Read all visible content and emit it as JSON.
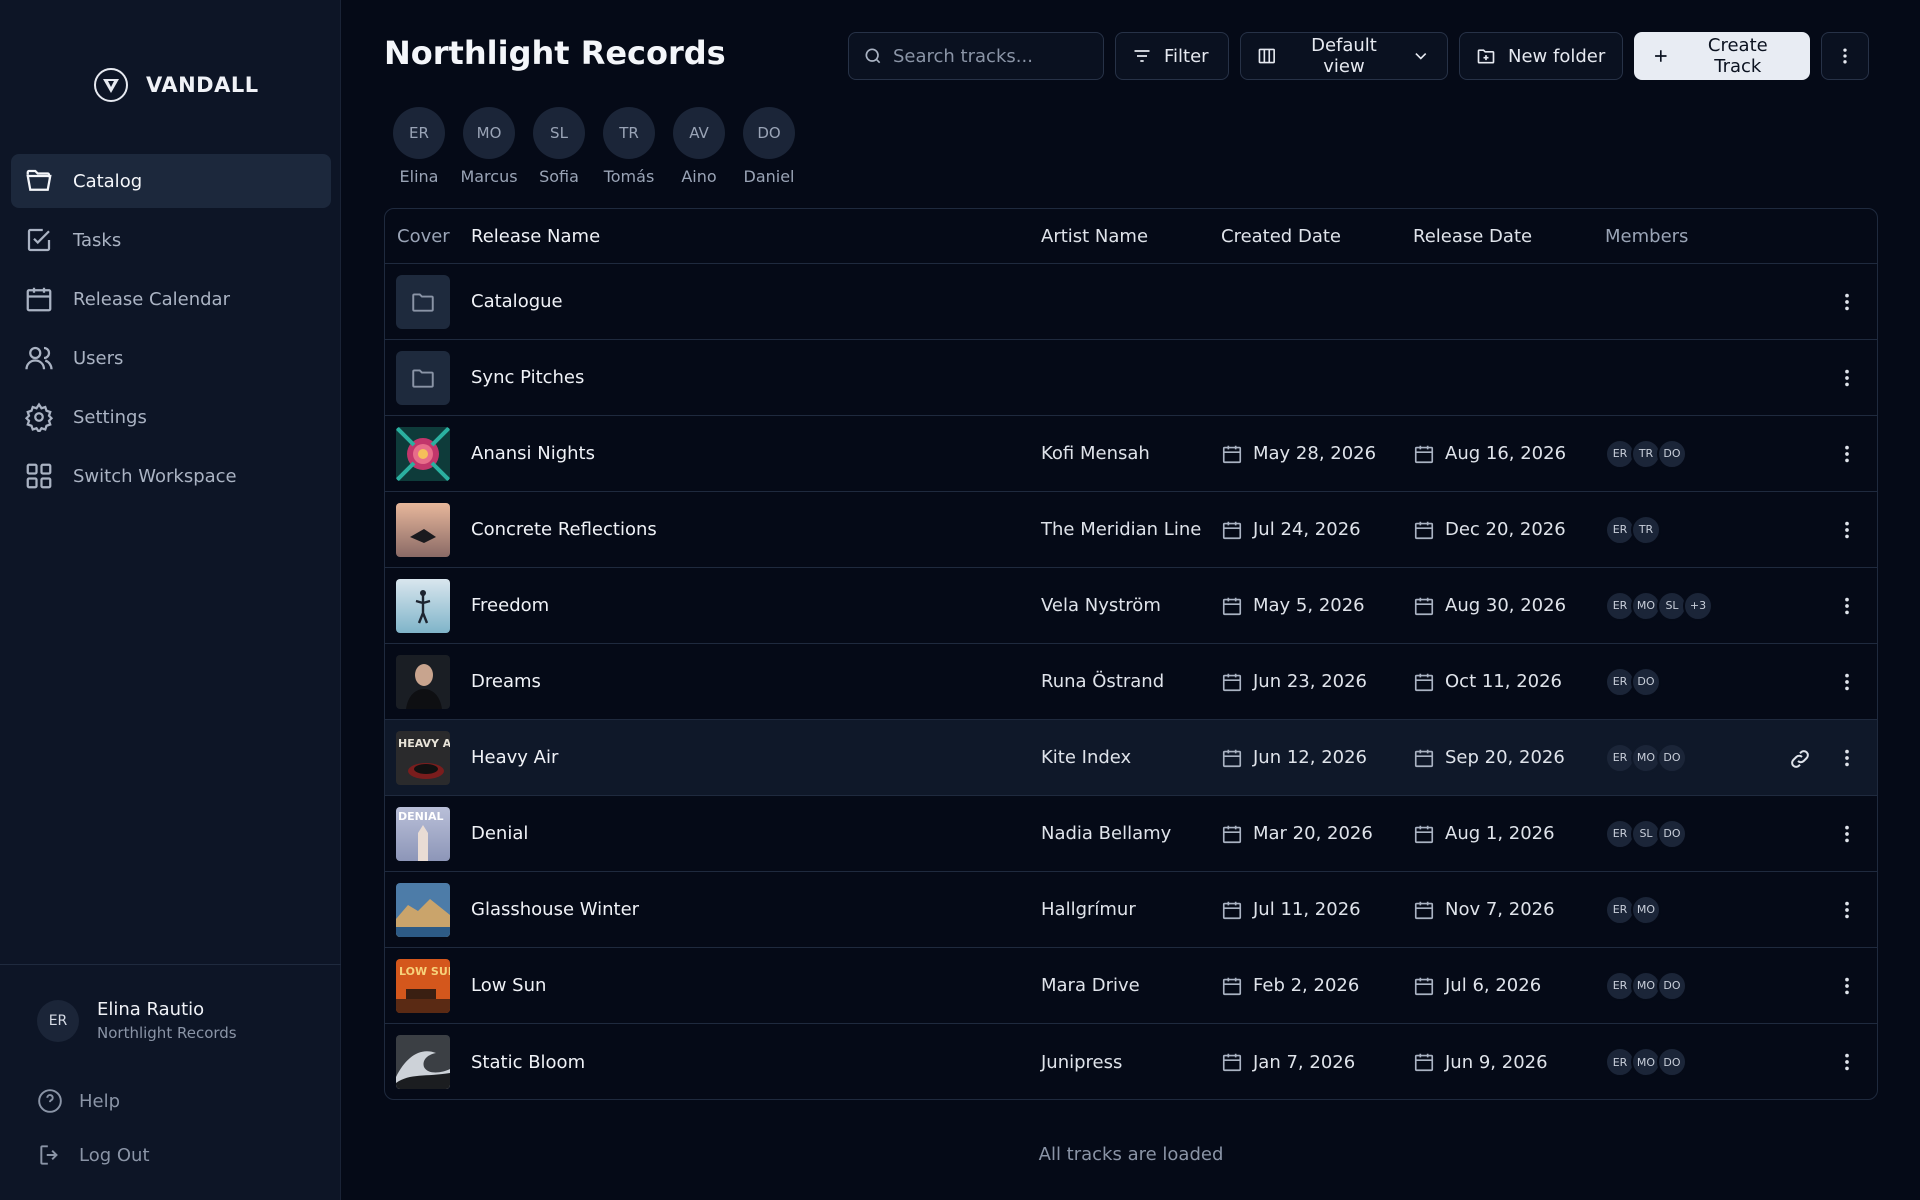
{
  "brand": {
    "name": "VANDALL",
    "logo_icon": "v-shield-icon"
  },
  "sidebar": {
    "items": [
      {
        "label": "Catalog",
        "icon": "folder-open-icon",
        "active": true
      },
      {
        "label": "Tasks",
        "icon": "checkbox-icon",
        "active": false
      },
      {
        "label": "Release Calendar",
        "icon": "calendar-icon",
        "active": false
      },
      {
        "label": "Users",
        "icon": "users-icon",
        "active": false
      },
      {
        "label": "Settings",
        "icon": "gear-icon",
        "active": false
      },
      {
        "label": "Switch Workspace",
        "icon": "grid-icon",
        "active": false
      }
    ],
    "user": {
      "initials": "ER",
      "name": "Elina Rautio",
      "org": "Northlight Records"
    },
    "help_label": "Help",
    "logout_label": "Log Out"
  },
  "header": {
    "title": "Northlight Records",
    "search_placeholder": "Search tracks...",
    "filter_label": "Filter",
    "view_label": "Default view",
    "new_folder_label": "New folder",
    "create_track_label": "Create Track"
  },
  "members": [
    {
      "initials": "ER",
      "name": "Elina"
    },
    {
      "initials": "MO",
      "name": "Marcus"
    },
    {
      "initials": "SL",
      "name": "Sofia"
    },
    {
      "initials": "TR",
      "name": "Tomás"
    },
    {
      "initials": "AV",
      "name": "Aino"
    },
    {
      "initials": "DO",
      "name": "Daniel"
    }
  ],
  "table": {
    "columns": {
      "cover": "Cover",
      "name": "Release Name",
      "artist": "Artist Name",
      "created": "Created Date",
      "release": "Release Date",
      "members": "Members"
    },
    "rows": [
      {
        "type": "folder",
        "name": "Catalogue"
      },
      {
        "type": "folder",
        "name": "Sync Pitches"
      },
      {
        "type": "track",
        "name": "Anansi Nights",
        "artist": "Kofi Mensah",
        "created": "May 28, 2026",
        "release": "Aug 16, 2026",
        "members": [
          "ER",
          "TR",
          "DO"
        ],
        "cover": "flower"
      },
      {
        "type": "track",
        "name": "Concrete Reflections",
        "artist": "The Meridian Line",
        "created": "Jul 24, 2026",
        "release": "Dec 20, 2026",
        "members": [
          "ER",
          "TR"
        ],
        "cover": "lake"
      },
      {
        "type": "track",
        "name": "Freedom",
        "artist": "Vela Nyström",
        "created": "May 5, 2026",
        "release": "Aug 30, 2026",
        "members": [
          "ER",
          "MO",
          "SL",
          "+3"
        ],
        "cover": "sky"
      },
      {
        "type": "track",
        "name": "Dreams",
        "artist": "Runa Östrand",
        "created": "Jun 23, 2026",
        "release": "Oct 11, 2026",
        "members": [
          "ER",
          "DO"
        ],
        "cover": "portrait"
      },
      {
        "type": "track",
        "name": "Heavy Air",
        "artist": "Kite Index",
        "created": "Jun 12, 2026",
        "release": "Sep 20, 2026",
        "members": [
          "ER",
          "MO",
          "DO"
        ],
        "cover": "heavy",
        "cover_text": "HEAVY AIR",
        "hover": true
      },
      {
        "type": "track",
        "name": "Denial",
        "artist": "Nadia Bellamy",
        "created": "Mar 20, 2026",
        "release": "Aug 1, 2026",
        "members": [
          "ER",
          "SL",
          "DO"
        ],
        "cover": "denial",
        "cover_text": "DENIAL"
      },
      {
        "type": "track",
        "name": "Glasshouse Winter",
        "artist": "Hallgrímur",
        "created": "Jul 11, 2026",
        "release": "Nov 7, 2026",
        "members": [
          "ER",
          "MO"
        ],
        "cover": "coast"
      },
      {
        "type": "track",
        "name": "Low Sun",
        "artist": "Mara Drive",
        "created": "Feb 2, 2026",
        "release": "Jul 6, 2026",
        "members": [
          "ER",
          "MO",
          "DO"
        ],
        "cover": "lowsun",
        "cover_text": "LOW SUN"
      },
      {
        "type": "track",
        "name": "Static Bloom",
        "artist": "Junipress",
        "created": "Jan 7, 2026",
        "release": "Jun 9, 2026",
        "members": [
          "ER",
          "MO",
          "DO"
        ],
        "cover": "wave"
      }
    ]
  },
  "status": "All tracks are loaded"
}
